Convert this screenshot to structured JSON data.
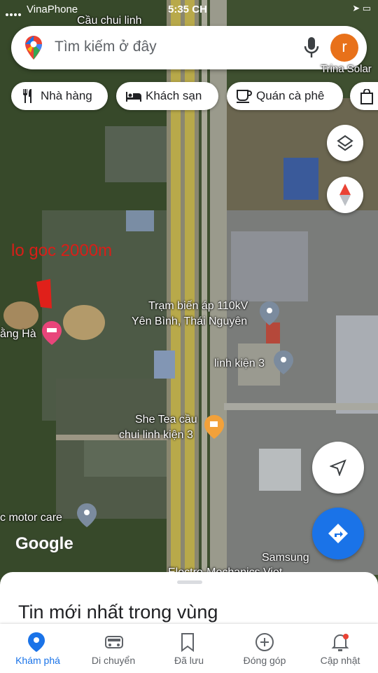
{
  "status_bar": {
    "carrier": "VinaPhone",
    "time": "5:35 CH"
  },
  "search": {
    "placeholder": "Tìm kiếm ở đây",
    "avatar_letter": "r"
  },
  "chips": [
    "Nhà hàng",
    "Khách sạn",
    "Quán cà phê"
  ],
  "map_labels": {
    "top_partial": "Cầu chui linh",
    "top_right_partial": "Trina Solar",
    "annotation": "lo goc 2000m",
    "substation_line1": "Trạm biến áp 110kV",
    "substation_line2": "Yên Bình, Thái Nguyên",
    "left_partial": "ằng Hà",
    "component": "linh kiện 3",
    "cafe_line1": "She Tea cầu",
    "cafe_line2": "chui linh kiện 3",
    "motor": "c motor care",
    "samsung": "Samsung",
    "bottom_partial": "Electro-Mechanics Viet"
  },
  "watermark": "Google",
  "sheet": {
    "title": "Tin mới nhất trong vùng"
  },
  "nav": [
    "Khám phá",
    "Di chuyển",
    "Đã lưu",
    "Đóng góp",
    "Cập nhật"
  ],
  "colors": {
    "accent": "#1a73e8",
    "annotation_red": "#d91e18",
    "avatar": "#e8711a"
  }
}
